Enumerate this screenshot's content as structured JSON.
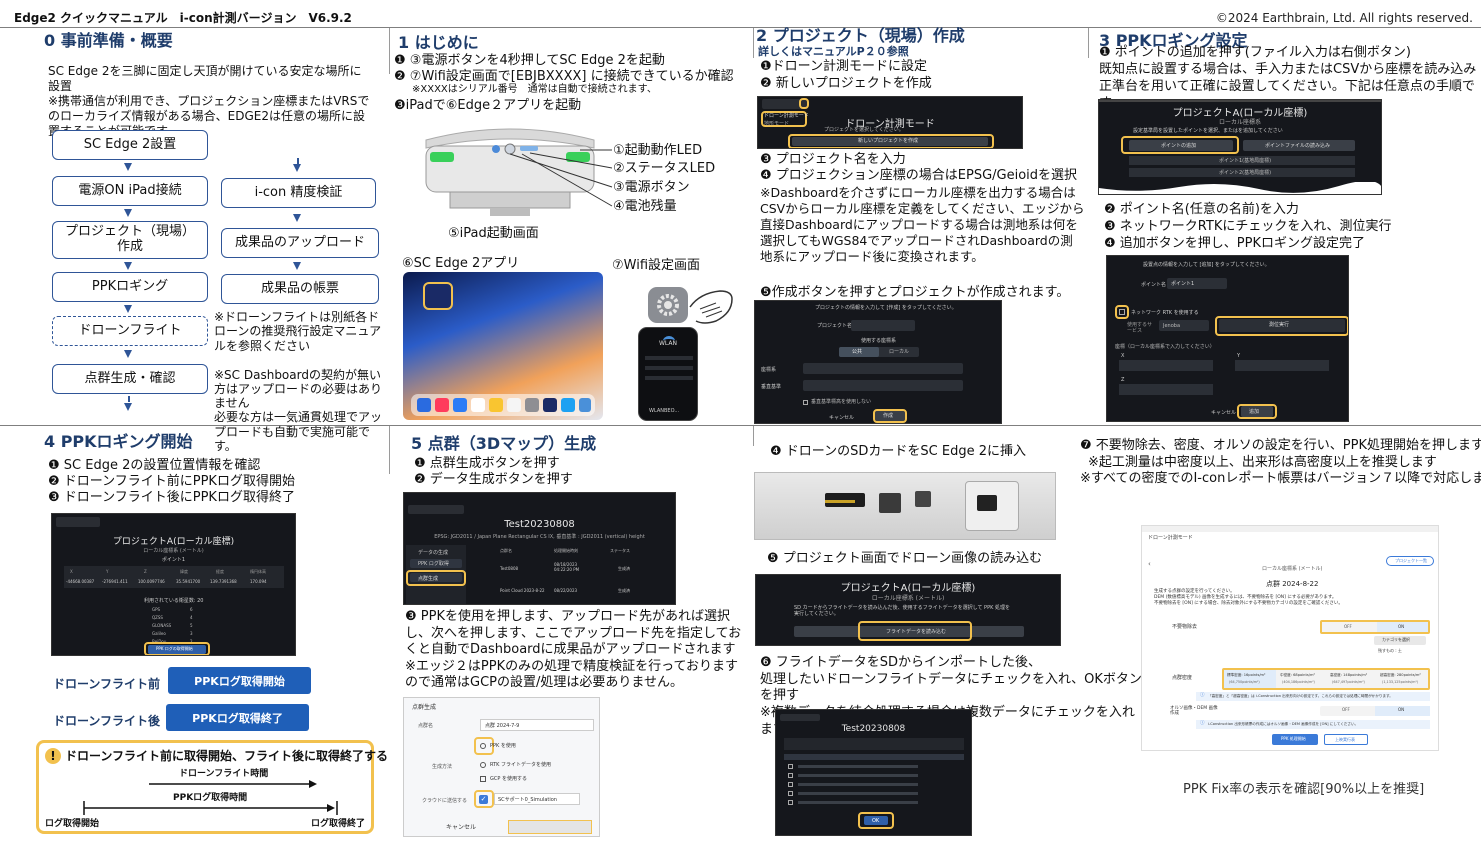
{
  "header": {
    "title": "Edge2 クイックマニュアル　i-con計測バージョン　V6.9.2",
    "copyright": "©2024 Earthbrain, Ltd. All rights reserved."
  },
  "s0": {
    "title": "0 事前準備・概要",
    "intro": "SC Edge 2を三脚に固定し天頂が開けている安定な場所に設置\n※携帯通信が利用でき、プロジェクション座標またはVRSでのローカライズ情報がある場合、EDGE2は任意の場所に設置することが可能です",
    "flow_left": [
      "SC Edge 2設置",
      "電源ON iPad接続",
      "プロジェクト（現場）\n作成",
      "PPKロギング",
      "ドローンフライト",
      "点群生成・確認"
    ],
    "flow_right": [
      "i-con 精度検証",
      "成果品のアップロード",
      "成果品の帳票"
    ],
    "note1": "※ドローンフライトは別紙各ドローンの推奨飛行設定マニュアルを参照ください",
    "note2": "※SC Dashboardの契約が無い方はアップロードの必要はありません\n必要な方は一気通貫処理でアップロードも自動で実施可能です。"
  },
  "s1": {
    "title": "1 はじめに",
    "step1": "❶ ③電源ボタンを4秒押してSC Edge 2を起動",
    "step2": "❷ ⑦Wifi設定画面で[EBJBXXXX] に接続できているか確認",
    "step2_note": "※XXXXはシリアル番号　通常は自動で接続されます、",
    "step3": "❸iPadで⑥Edge２アプリを起動",
    "labels": [
      "①起動動作LED",
      "②ステータスLED",
      "③電源ボタン",
      "④電池残量"
    ],
    "ipad_caption": "⑤iPad起動画面",
    "app_caption": "⑥SC Edge 2アプリ",
    "wifi_caption": "⑦Wifi設定画面",
    "wifi_screen_label": "WLAN",
    "wifi_ssid": "WLANBEO..."
  },
  "s2": {
    "title": "2 プロジェクト（現場）作成",
    "subtitle": "詳しくはマニュアルP２０参照",
    "step1": "❶ドローン計測モードに設定",
    "step2": "❷ 新しいプロジェクトを作成",
    "screen1_title": "ドローン計測モード",
    "screen1_menu": [
      "ドローン計測モード",
      "地形モード"
    ],
    "screen1_prompt": "プロジェクトを選択してください。",
    "screen1_button": "新しいプロジェクトを作成",
    "step3": "❸ プロジェクト名を入力",
    "step4": "❹ プロジェクション座標の場合はEPSG/Geioidを選択",
    "note": "※Dashboardを介さずにローカル座標を出力する場合はCSVからローカル座標を定義をしてください、エッジから直接Dashboardにアップロードする場合は測地系は何を選択してもWGS84でアップロードされDashboardの測地系にアップロード後に変換されます。",
    "step5": "❺作成ボタンを押すとプロジェクトが作成されます。",
    "screen2_prompt": "プロジェクトの情報を入力して [作成] をタップしてください。",
    "screen2_fields": [
      "プロジェクト名",
      "座標系",
      "垂直基準"
    ],
    "screen2_toggle_label": "使用する座標系",
    "screen2_toggle": [
      "公共",
      "ローカル"
    ],
    "screen2_checkbox": "垂直基準標高を使用しない",
    "screen2_buttons": [
      "キャンセル",
      "作成"
    ]
  },
  "s3": {
    "title": "3 PPKロギング設定",
    "step1": "❶ ポイントの追加を押す(ファイル入力は右側ボタン)",
    "step1_note": "既知点に設置する場合は、手入力またはCSVから座標を読み込み正準台を用いて正確に設置してください。下記は任意点の手順です",
    "screen1_title": "プロジェクトA(ローカル座標)",
    "screen1_sub": "ローカル座標系",
    "screen1_prompt": "設定基準局を設置したポイントを選択、またはを追加してください",
    "screen1_buttons": [
      "ポイントの追加",
      "ポイントファイルの読み込み"
    ],
    "screen1_rows": [
      "ポイント1(基地局座標)",
      "ポイント2(基地局座標)"
    ],
    "step2": "❷ ポイント名(任意の名前)を入力",
    "step3": "❸ ネットワークRTKにチェックを入れ、測位実行",
    "step4": "❹ 追加ボタンを押し、PPKロギング設定完了",
    "screen2_prompt": "設置点の情報を入力して [追加] をタップしてください。",
    "screen2_point_label": "ポイント名",
    "screen2_point_value": "ポイント1",
    "screen2_rtk": "ネットワーク RTK を使用する",
    "screen2_service_label": "使用するサービス",
    "screen2_service_value": "Jenoba",
    "screen2_measure": "測位実行",
    "screen2_coord_label": "座標（ローカル座標系で入力してください）",
    "screen2_axes": [
      "X",
      "Y",
      "Z"
    ],
    "screen2_buttons": [
      "キャンセル",
      "追加"
    ]
  },
  "s4": {
    "title": "4 PPKロギング開始",
    "step1": "❶ SC Edge 2の設置位置情報を確認",
    "step2": "❷ ドローンフライト前にPPKログ取得開始",
    "step3": "❸ ドローンフライト後にPPKログ取得終了",
    "screen_title": "プロジェクトA(ローカル座標)",
    "screen_sub": "ローカル座標系 (メートル)",
    "screen_point": "ポイント1",
    "screen_headers": [
      "X",
      "Y",
      "Z",
      "緯度",
      "経度",
      "楕円体高"
    ],
    "screen_values": [
      "-44668.00387",
      "-276941.411",
      "100.0097746",
      "35.5941700",
      "139.7391368",
      "170.094"
    ],
    "screen_count": "利用されている衛星数: 20",
    "screen_sats": [
      [
        "GPS",
        "6"
      ],
      [
        "QZSS",
        "4"
      ],
      [
        "GLONASS",
        "5"
      ],
      [
        "Galileo",
        "3"
      ],
      [
        "BeiDou",
        "2"
      ]
    ],
    "screen_button": "PPK ログの取得開始",
    "before_label": "ドローンフライト前",
    "before_button": "PPKログ取得開始",
    "after_label": "ドローンフライト後",
    "after_button": "PPKログ取得終了",
    "warning": "ドローンフライト前に取得開始、フライト後に取得終了する",
    "timeline_flight": "ドローンフライト時間",
    "timeline_log": "PPKログ取得時間",
    "timeline_start": "ログ取得開始",
    "timeline_end": "ログ取得終了"
  },
  "s5": {
    "title": "5 点群（3Dマップ）生成",
    "step1": "❶ 点群生成ボタンを押す",
    "step2": "❷ データ生成ボタンを押す",
    "screen_title": "Test20230808",
    "screen_sub": "EPSG: JGD2011 / Japan Plane Rectangular CS IX, 垂直基準 : JGD2011 (vertical) height",
    "screen_side": [
      "データの生成",
      "PPK ログ取得",
      "点群生成"
    ],
    "screen_headers": [
      "点群名",
      "処理開始時刻",
      "ステータス"
    ],
    "screen_rows": [
      [
        "Test0808",
        "08/18/2023\n04:22:20 PM",
        "生成済"
      ],
      [
        "Point Cloud 2023-8-22",
        "08/22/2023",
        "生成済"
      ]
    ],
    "step3": "❸ PPKを使用を押します、アップロード先があれば選択し、次へを押します、ここでアップロード先を指定しておくと自動でDashboardに成果品がアップロードされます\n※エッジ２はPPKのみの処理で精度検証を行っておりますので通常はGCPの設置/処理は必要ありません。",
    "form_title": "点群生成",
    "form_name_label": "点群名",
    "form_name_value": "点群 2024-7-9",
    "form_method_label": "生成方法",
    "form_options": [
      "PPK を使用",
      "RTK フライトデータを使用",
      "GCP を使用する"
    ],
    "form_cloud_label": "クラウドに送信する",
    "form_cloud_value": "SCサポート0_Simulation",
    "form_cancel": "キャンセル"
  },
  "s6": {
    "step4": "❹ ドローンのSDカードをSC Edge 2に挿入",
    "step5": "❺ プロジェクト画面でドローン画像の読み込む",
    "screen_title": "プロジェクトA(ローカル座標)",
    "screen_sub": "ローカル座標系 (メートル)",
    "screen_prompt": "SD カードからフライトデータを読み込んだ後、使用するフライトデータを選択して PPK 処理を実行してください。",
    "screen_button": "フライトデータを読み込む",
    "step6": "❻ フライトデータをSDからインポートした後、\n処理したいドローンフライトデータにチェックを入れ、OKボタンを押す\n※複数データを結合処理する場合は複数データにチェックを入れます",
    "screen2_title": "Test20230808",
    "screen2_ok": "OK"
  },
  "s7": {
    "step7": "❼ 不要物除去、密度、オルソの設定を行い、PPK処理開始を押します",
    "note1": "※起工測量は中密度以上、出来形は高密度以上を推奨します",
    "note2": "※すべての密度でのI-conレポート帳票はバージョン７以降で対応します",
    "screen_title": "点群 2024-8-22",
    "screen_project": "ローカル座標系 (メートル)",
    "screen_mode": "ドローン計測モード",
    "screen_back": "プロジェクト一覧",
    "screen_notes": "生成する点群の設定を行ってください。\nDEM (数値標高モデル) 画像を生成するには、不要物除去を [ON] にする必要があります。\n不要物除去を [ON] にする場合、除去対象外にする不要物カテゴリの設定をご確認ください。",
    "rows": [
      "不要物除去",
      "点群密度",
      "オルソ画像・DEM 画像作成"
    ],
    "toggle": [
      "OFF",
      "ON"
    ],
    "category_btn": "カテゴリを選択",
    "tree_note": "残すもの : 土",
    "density": [
      "標準密度: 16points/m²",
      "中密度: 68points/m²",
      "高密度: 148points/m²",
      "超高密度: 280points/m²"
    ],
    "density_sub": [
      "(64,750points/m²)",
      "(404,186points/m²)",
      "(647,497points/m²)",
      "(1,133,125points/m²)"
    ],
    "info1": "「高密度」と「超高密度」は i-Construction 出来形向けの設定です。これらの設定では処理に時間がかかります。",
    "info2": "i-Construction 出来形帳票の作成にはオルソ画像・DEM 画像作成を [ON] にしてください。",
    "buttons": [
      "PPK 処理開始",
      "上映実行表"
    ],
    "caption": "PPK Fix率の表示を確認[90%以上を推奨]"
  }
}
